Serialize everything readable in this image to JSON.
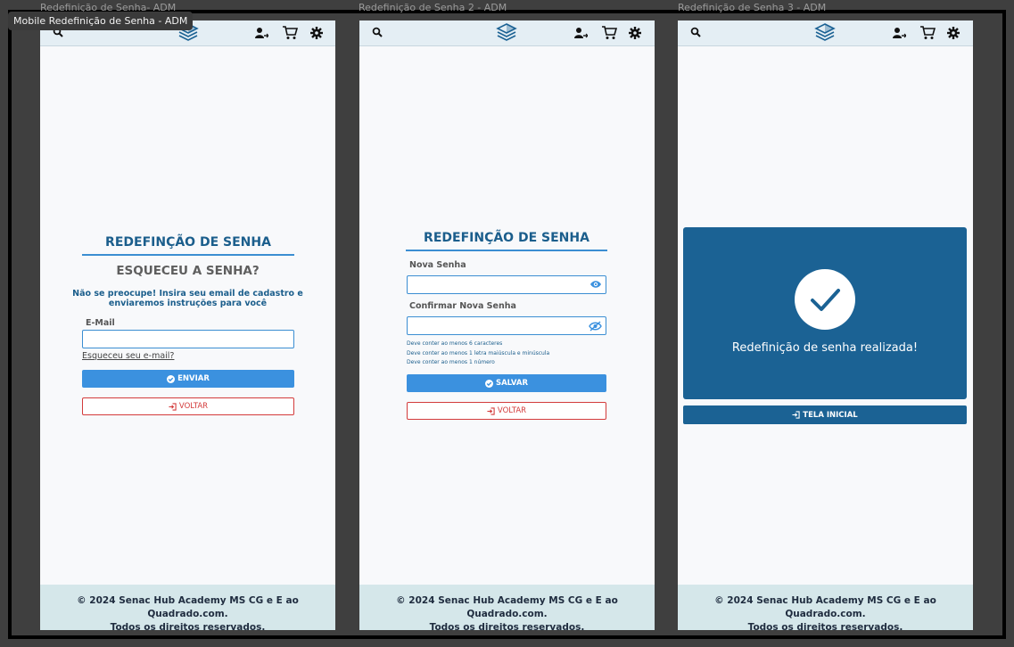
{
  "tooltip": "Mobile Redefinição de Senha - ADM",
  "frames": {
    "f1_label": "Redefinição de Senha- ADM",
    "f2_label": "Redefinição de Senha 2 - ADM",
    "f3_label": "Redefinição de Senha 3 - ADM"
  },
  "topbar_icons": [
    "search-icon",
    "logo-icon",
    "user-add-icon",
    "cart-icon",
    "gear-icon"
  ],
  "screen1": {
    "title": "REDEFINÇÃO DE SENHA",
    "subtitle": "ESQUECEU A SENHA?",
    "desc_line1": "Não se preocupe! Insira seu email de cadastro e",
    "desc_line2": "enviaremos instruções para você",
    "email_label": "E-Mail",
    "forgot_link": "Esqueceu seu e-mail?",
    "send_button": "ENVIAR",
    "back_button": "VOLTAR"
  },
  "screen2": {
    "title": "REDEFINÇÃO DE SENHA",
    "new_password_label": "Nova Senha",
    "confirm_password_label": "Confirmar Nova Senha",
    "hint1": "Deve conter ao menos 6 caracteres",
    "hint2": "Deve conter ao menos 1 letra maiúscula e minúscula",
    "hint3": "Deve conter ao menos 1 número",
    "save_button": "SALVAR",
    "back_button": "VOLTAR"
  },
  "screen3": {
    "success_message": "Redefinição de senha realizada!",
    "home_button": "TELA INICIAL"
  },
  "footer": {
    "line1": "© 2024 Senac Hub Academy MS CG e E ao Quadrado.com.",
    "line2": "Todos os direitos reservados."
  },
  "colors": {
    "accent": "#3b91df",
    "title_blue": "#1b5e8c",
    "card_blue": "#1b6294",
    "danger": "#d33b3b",
    "footer_bg": "#d5e7ea",
    "topbar_bg": "#e4eef4"
  }
}
